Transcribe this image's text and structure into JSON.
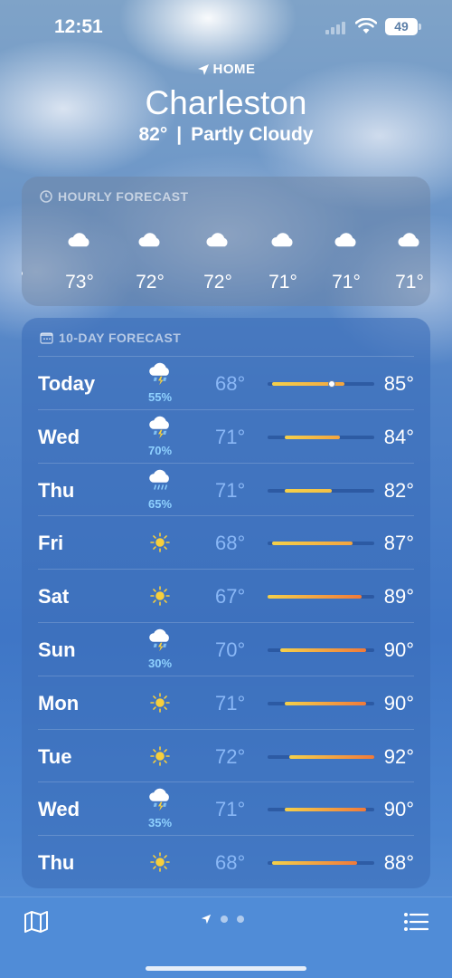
{
  "status": {
    "time": "12:51",
    "battery": "49"
  },
  "location": {
    "label": "HOME",
    "city": "Charleston",
    "current_temp": "82°",
    "separator": "|",
    "condition": "Partly Cloudy"
  },
  "hourly": {
    "title": "HOURLY FORECAST",
    "icon": "clock-icon",
    "partial_temp": "°",
    "items": [
      {
        "icon": "cloud-icon",
        "temp": "73°"
      },
      {
        "icon": "cloud-icon",
        "temp": "72°"
      },
      {
        "icon": "cloud-icon",
        "temp": "72°"
      },
      {
        "icon": "cloud-icon",
        "temp": "71°"
      },
      {
        "icon": "cloud-icon",
        "temp": "71°"
      },
      {
        "icon": "cloud-icon",
        "temp": "71°"
      }
    ]
  },
  "daily": {
    "title": "10-DAY FORECAST",
    "icon": "calendar-icon",
    "range_min": 67,
    "range_max": 92,
    "current_temp": 82,
    "days": [
      {
        "day": "Today",
        "icon": "thunderstorm-icon",
        "pop": "55%",
        "low": "68°",
        "high": "85°",
        "low_val": 68,
        "high_val": 85
      },
      {
        "day": "Wed",
        "icon": "thunderstorm-icon",
        "pop": "70%",
        "low": "71°",
        "high": "84°",
        "low_val": 71,
        "high_val": 84
      },
      {
        "day": "Thu",
        "icon": "rain-icon",
        "pop": "65%",
        "low": "71°",
        "high": "82°",
        "low_val": 71,
        "high_val": 82
      },
      {
        "day": "Fri",
        "icon": "sun-icon",
        "pop": "",
        "low": "68°",
        "high": "87°",
        "low_val": 68,
        "high_val": 87
      },
      {
        "day": "Sat",
        "icon": "sun-icon",
        "pop": "",
        "low": "67°",
        "high": "89°",
        "low_val": 67,
        "high_val": 89
      },
      {
        "day": "Sun",
        "icon": "thunderstorm-icon",
        "pop": "30%",
        "low": "70°",
        "high": "90°",
        "low_val": 70,
        "high_val": 90
      },
      {
        "day": "Mon",
        "icon": "sun-icon",
        "pop": "",
        "low": "71°",
        "high": "90°",
        "low_val": 71,
        "high_val": 90
      },
      {
        "day": "Tue",
        "icon": "sun-icon",
        "pop": "",
        "low": "72°",
        "high": "92°",
        "low_val": 72,
        "high_val": 92
      },
      {
        "day": "Wed",
        "icon": "thunderstorm-icon",
        "pop": "35%",
        "low": "71°",
        "high": "90°",
        "low_val": 71,
        "high_val": 90
      },
      {
        "day": "Thu",
        "icon": "sun-icon",
        "pop": "",
        "low": "68°",
        "high": "88°",
        "low_val": 68,
        "high_val": 88
      }
    ]
  },
  "toolbar": {
    "map_icon": "map-icon",
    "list_icon": "list-icon",
    "location_icon": "location-arrow-icon"
  },
  "colors": {
    "bar_cool": "#f5d04a",
    "bar_warm": "#f07a3a",
    "pop_text": "#8fd1ff",
    "sun": "#f7cf3c"
  }
}
